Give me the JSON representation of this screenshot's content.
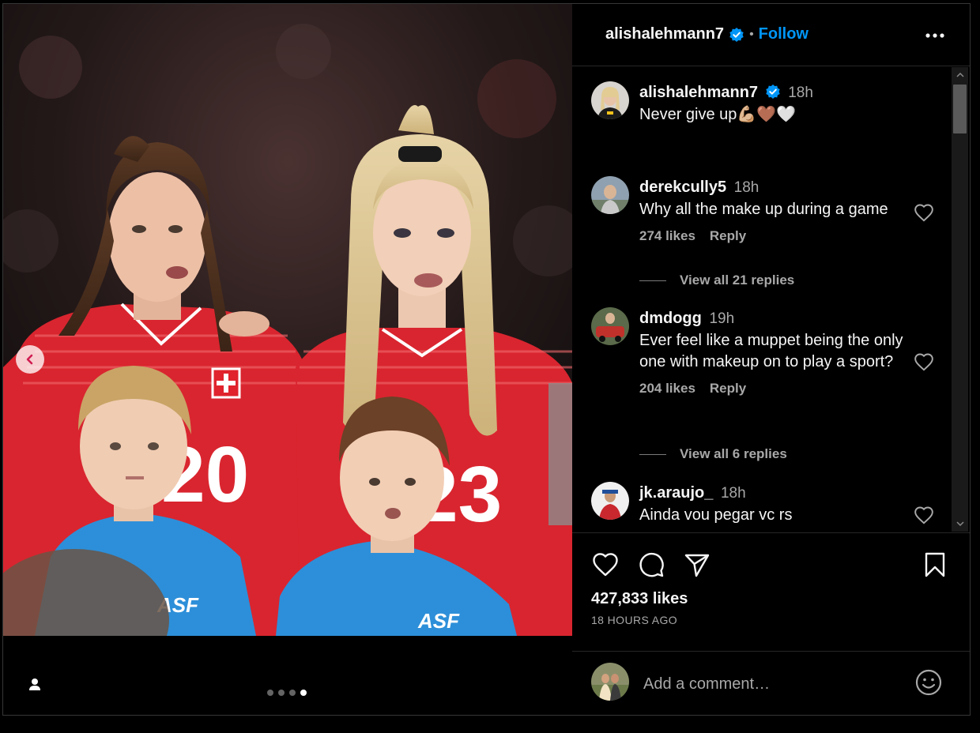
{
  "header": {
    "username": "alishalehmann7",
    "separator": "•",
    "follow_label": "Follow"
  },
  "caption": {
    "username": "alishalehmann7",
    "time": "18h",
    "text": "Never give up💪🏼🤎🤍"
  },
  "comments": [
    {
      "username": "derekcully5",
      "time": "18h",
      "text": "Why all the make up during a game",
      "likes": "274 likes",
      "reply_label": "Reply",
      "view_replies": "View all 21 replies"
    },
    {
      "username": "dmdogg",
      "time": "19h",
      "text": "Ever feel like a muppet being the only one with makeup on to play a sport?",
      "likes": "204 likes",
      "reply_label": "Reply",
      "view_replies": "View all 6 replies"
    },
    {
      "username": "jk.araujo_",
      "time": "18h",
      "text": "Ainda vou pegar vc rs"
    }
  ],
  "post": {
    "likes": "427,833 likes",
    "time_ago": "18 HOURS AGO"
  },
  "add_comment": {
    "placeholder": "Add a comment…"
  },
  "carousel": {
    "count": 4,
    "active_index": 3
  },
  "colors": {
    "accent": "#0095f6",
    "background": "#000000",
    "text_primary": "#f5f5f5",
    "text_secondary": "#a8a8a8",
    "jersey_red": "#d9252f",
    "kid_shirt_blue": "#2d8fd9"
  },
  "icons": [
    "verified-badge-icon",
    "more-options-icon",
    "heart-icon",
    "comment-icon",
    "share-icon",
    "bookmark-icon",
    "emoji-icon",
    "chevron-left-icon",
    "user-tag-icon"
  ]
}
